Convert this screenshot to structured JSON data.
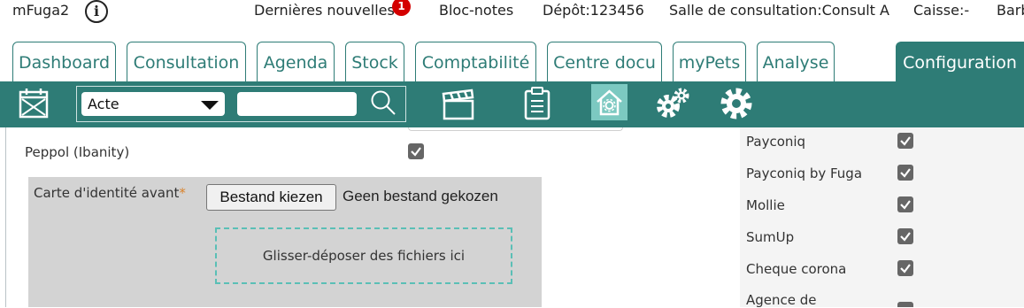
{
  "header": {
    "app_name": "mFuga2",
    "info_icon": "info-icon",
    "news_label": "Dernières nouvelles",
    "news_badge": "1",
    "notes_label": "Bloc-notes",
    "depot_label": "Dépôt:123456",
    "room_label": "Salle de consultation:Consult A",
    "cash_label": "Caisse:-",
    "user_label": "Barb"
  },
  "tabs": [
    {
      "label": "Dashboard"
    },
    {
      "label": "Consultation"
    },
    {
      "label": "Agenda"
    },
    {
      "label": "Stock"
    },
    {
      "label": "Comptabilité"
    },
    {
      "label": "Centre docu"
    },
    {
      "label": "myPets"
    },
    {
      "label": "Analyse"
    },
    {
      "label": "Configuration",
      "active": true
    }
  ],
  "toolbar": {
    "icons": [
      "calendar-icon",
      "clapperboard-icon",
      "clipboard-icon",
      "home-settings-icon",
      "gears-icon",
      "gear-icon"
    ],
    "select_value": "Acte",
    "search_value": "",
    "search_icon": "search-icon",
    "active_icon": "home-settings-icon"
  },
  "main": {
    "peppol_label": "Peppol (Ibanity)",
    "peppol_checked": true,
    "id_card_label": "Carte d'identité avant",
    "required_mark": "*",
    "file_button_label": "Bestand kiezen",
    "no_file_label": "Geen bestand gekozen",
    "dropzone_label": "Glisser-déposer des fichiers ici"
  },
  "payment_options": [
    {
      "label": "Payconiq",
      "checked": true
    },
    {
      "label": "Payconiq by Fuga",
      "checked": true
    },
    {
      "label": "Mollie",
      "checked": true
    },
    {
      "label": "SumUp",
      "checked": true
    },
    {
      "label": "Cheque corona",
      "checked": true
    },
    {
      "label": "Agence de",
      "checked": true
    }
  ],
  "colors": {
    "accent": "#2e7c76",
    "highlight": "#7cc9c1",
    "badge": "#d40000",
    "dropzone_border": "#5abfb6"
  }
}
